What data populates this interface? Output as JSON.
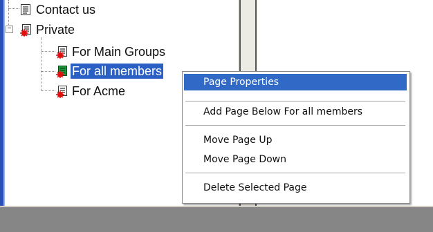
{
  "tree": {
    "items": [
      {
        "label": "Contact us"
      },
      {
        "label": "Private",
        "expander": "−"
      },
      {
        "label": "For Main Groups"
      },
      {
        "label": "For all members"
      },
      {
        "label": "For Acme"
      }
    ]
  },
  "context_menu": {
    "page_properties": "Page Properties",
    "add_page_below": "Add Page Below For all members",
    "move_page_up": "Move Page Up",
    "move_page_down": "Move Page Down",
    "delete_selected_page": "Delete Selected Page"
  },
  "colors": {
    "selection": "#2a5fc4",
    "menu_highlight": "#3169c6",
    "lock_marker": "#e01010",
    "selected_page_icon": "#1e9a3c"
  },
  "icons": {
    "page": "page-icon",
    "locked_page": "locked-page-icon",
    "collapse": "collapse-icon"
  }
}
